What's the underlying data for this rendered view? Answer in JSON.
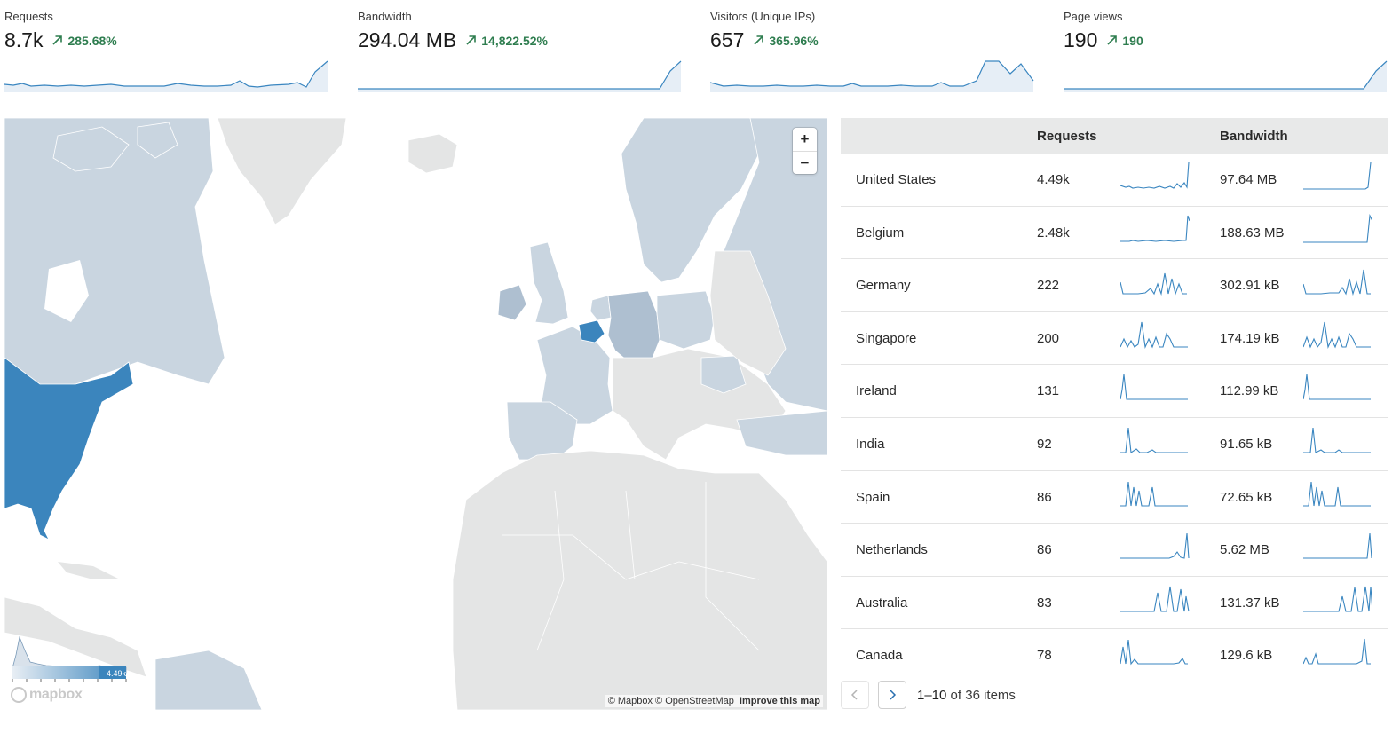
{
  "colors": {
    "accent": "#3a86c0",
    "positive": "#2e7d4f",
    "map_base": "#e4e5e5",
    "map_light": "#c9d5e0",
    "map_mid": "#aebfd0",
    "map_strong": "#3b85bd"
  },
  "stats": [
    {
      "label": "Requests",
      "value": "8.7k",
      "delta": "285.68%",
      "icon": "arrow-up-right-icon"
    },
    {
      "label": "Bandwidth",
      "value": "294.04 MB",
      "delta": "14,822.52%",
      "icon": "arrow-up-right-icon"
    },
    {
      "label": "Visitors (Unique IPs)",
      "value": "657",
      "delta": "365.96%",
      "icon": "arrow-up-right-icon"
    },
    {
      "label": "Page views",
      "value": "190",
      "delta": "190",
      "icon": "arrow-up-right-icon"
    }
  ],
  "map": {
    "zoom_in": "+",
    "zoom_out": "−",
    "attribution": "© Mapbox © OpenStreetMap",
    "improve": "Improve this map",
    "logo": "mapbox",
    "legend_max": "4.49k"
  },
  "table": {
    "col_requests": "Requests",
    "col_bandwidth": "Bandwidth",
    "rows": [
      {
        "country": "United States",
        "requests": "4.49k",
        "bandwidth": "97.64 MB"
      },
      {
        "country": "Belgium",
        "requests": "2.48k",
        "bandwidth": "188.63 MB"
      },
      {
        "country": "Germany",
        "requests": "222",
        "bandwidth": "302.91 kB"
      },
      {
        "country": "Singapore",
        "requests": "200",
        "bandwidth": "174.19 kB"
      },
      {
        "country": "Ireland",
        "requests": "131",
        "bandwidth": "112.99 kB"
      },
      {
        "country": "India",
        "requests": "92",
        "bandwidth": "91.65 kB"
      },
      {
        "country": "Spain",
        "requests": "86",
        "bandwidth": "72.65 kB"
      },
      {
        "country": "Netherlands",
        "requests": "86",
        "bandwidth": "5.62 MB"
      },
      {
        "country": "Australia",
        "requests": "83",
        "bandwidth": "131.37 kB"
      },
      {
        "country": "Canada",
        "requests": "78",
        "bandwidth": "129.6 kB"
      }
    ]
  },
  "pager": {
    "range": "1–10",
    "of_text": "of 36 items",
    "prev_icon": "chevron-left-icon",
    "next_icon": "chevron-right-icon"
  }
}
